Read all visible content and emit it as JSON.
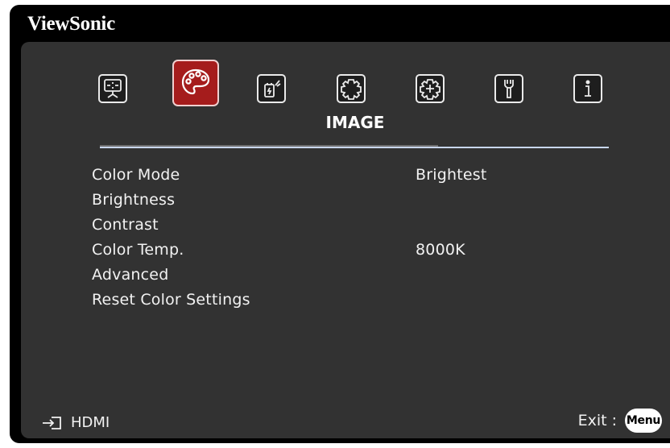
{
  "brand": "ViewSonic",
  "tabs": [
    {
      "icon": "display-icon",
      "active": false
    },
    {
      "icon": "palette-icon",
      "active": true
    },
    {
      "icon": "power-icon",
      "active": false
    },
    {
      "icon": "settings-gear-icon",
      "active": false
    },
    {
      "icon": "advanced-settings-icon",
      "active": false
    },
    {
      "icon": "wrench-icon",
      "active": false
    },
    {
      "icon": "info-icon",
      "active": false
    }
  ],
  "section_title": "IMAGE",
  "menu": [
    {
      "label": "Color Mode",
      "value": "Brightest"
    },
    {
      "label": "Brightness",
      "value": ""
    },
    {
      "label": "Contrast",
      "value": ""
    },
    {
      "label": "Color Temp.",
      "value": "8000K"
    },
    {
      "label": "Advanced",
      "value": ""
    },
    {
      "label": "Reset Color Settings",
      "value": ""
    }
  ],
  "footer": {
    "source": "HDMI",
    "exit_label": "Exit :",
    "menu_button": "Menu"
  },
  "colors": {
    "active_tab": "#a51c1c",
    "panel": "#323232"
  }
}
